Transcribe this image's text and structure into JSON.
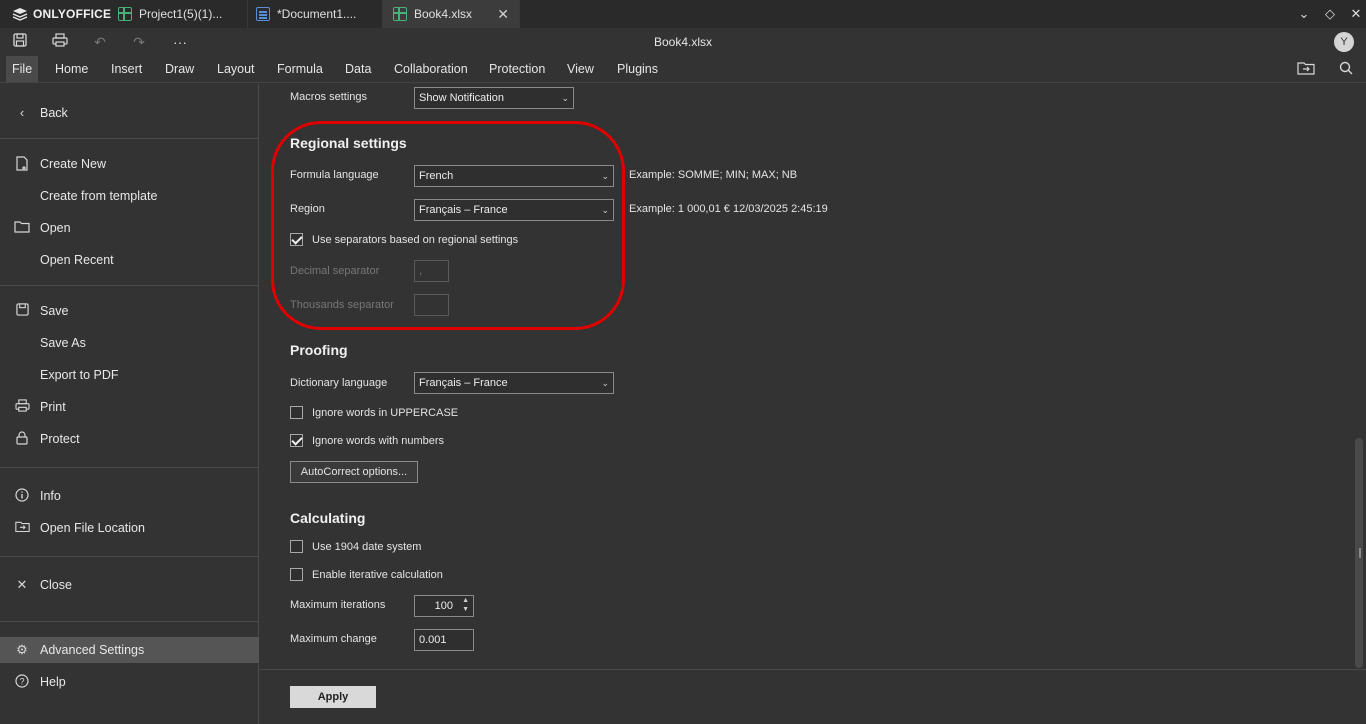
{
  "app": {
    "brand": "ONLYOFFICE",
    "document_title": "Book4.xlsx",
    "avatar_initial": "Y"
  },
  "tabs": [
    {
      "label": "Project1(5)(1)...",
      "type": "sheet"
    },
    {
      "label": "*Document1....",
      "type": "doc"
    },
    {
      "label": "Book4.xlsx",
      "type": "sheet",
      "active": true
    }
  ],
  "menu": [
    "File",
    "Home",
    "Insert",
    "Draw",
    "Layout",
    "Formula",
    "Data",
    "Collaboration",
    "Protection",
    "View",
    "Plugins"
  ],
  "sidebar": {
    "back": "Back",
    "create_new": "Create New",
    "create_from_template": "Create from template",
    "open": "Open",
    "open_recent": "Open Recent",
    "save": "Save",
    "save_as": "Save As",
    "export_pdf": "Export to PDF",
    "print": "Print",
    "protect": "Protect",
    "info": "Info",
    "open_file_location": "Open File Location",
    "close": "Close",
    "advanced_settings": "Advanced Settings",
    "help": "Help"
  },
  "settings": {
    "macros_label": "Macros settings",
    "macros_value": "Show Notification",
    "regional": {
      "title": "Regional settings",
      "formula_language_label": "Formula language",
      "formula_language_value": "French",
      "formula_example": "Example: SOMME; MIN; MAX; NB",
      "region_label": "Region",
      "region_value": "Français – France",
      "region_example": "Example: 1 000,01 € 12/03/2025 2:45:19",
      "use_separators_label": "Use separators based on regional settings",
      "decimal_label": "Decimal separator",
      "decimal_value": ",",
      "thousands_label": "Thousands separator",
      "thousands_value": ""
    },
    "proofing": {
      "title": "Proofing",
      "dictionary_label": "Dictionary language",
      "dictionary_value": "Français – France",
      "ignore_uppercase_label": "Ignore words in UPPERCASE",
      "ignore_numbers_label": "Ignore words with numbers",
      "autocorrect_button": "AutoCorrect options..."
    },
    "calculating": {
      "title": "Calculating",
      "use_1904_label": "Use 1904 date system",
      "iterative_label": "Enable iterative calculation",
      "max_iterations_label": "Maximum iterations",
      "max_iterations_value": "100",
      "max_change_label": "Maximum change",
      "max_change_value": "0.001"
    },
    "apply_button": "Apply"
  },
  "colors": {
    "highlight": "#e00000",
    "sheet_icon": "#4caf7a",
    "doc_icon": "#5b8ed8"
  }
}
